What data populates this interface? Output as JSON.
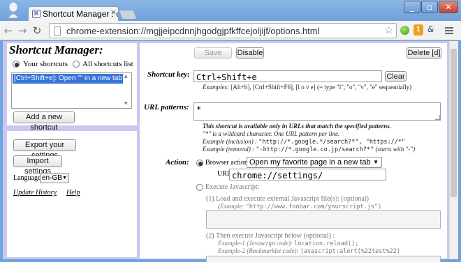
{
  "browser": {
    "tab_title": "Shortcut Manager : option",
    "address": "chrome-extension://mgjjeipcdnnjhgodgjpfkffcejoljijf/options.html",
    "ext_badge": "1"
  },
  "sidebar": {
    "title": "Shortcut Manager:",
    "view_options": [
      "Your shortcuts",
      "All shortcuts list"
    ],
    "selected_view": "Your shortcuts",
    "shortcut_list_item": "[Ctrl+Shift+e]: Open \"\" in a new tab",
    "add_button": "Add a new shortcut",
    "export_button": "Export your settings",
    "import_button": "Import settings",
    "language_label": "Language:",
    "language_value": "en-GB",
    "update_history_link": "Update History",
    "help_link": "Help"
  },
  "actions": {
    "save": "Save",
    "disable": "Disable",
    "delete": "Delete [d]"
  },
  "shortcut_key": {
    "label": "Shortcut key:",
    "value": "Ctrl+Shift+e",
    "clear": "Clear",
    "examples_prefix": "Examples:",
    "examples": "[Alt+b], [Ctrl+Shift+F6], [l o v e] (= type \"l\", \"o\", \"v\", \"e\" sequentially)"
  },
  "url_patterns": {
    "label": "URL patterns:",
    "value": "*",
    "note1": "This shortcut is available only in URLs that match the specified patterns.",
    "note2": "\"*\" is a wildcard character. One URL pattern per line.",
    "inclusion_label": "Example (inclusion) :",
    "inclusion_code": "\"http://*.google.*/search?*\", \"https://*\"",
    "removal_label": "Example (removal) :",
    "removal_code": "\"-http://*.google.co.jp/search?*\"",
    "removal_suffix": "(starts with \"-\")"
  },
  "action": {
    "label": "Action:",
    "browser_action_label": "Browser action:",
    "browser_action_value": "Open my favorite page in a new tab",
    "url_label": "URL:",
    "url_value": "chrome://settings/",
    "execute_js_label": "Execute Javascript:",
    "step1_label": "(1) Load and execute external Javascript file(s): (optional)",
    "step1_example_prefix": "(Example:",
    "step1_example_code": "\"http://www.foobar.com/yourscript.js\")",
    "step2_label": "(2) Then execute Javascript below (optional) :",
    "example1_label": "Example-1 (Javascript code):",
    "example1_code": "location.reload();",
    "example2_label": "Example-2 (Bookmarklet code):",
    "example2_code": "javascript:alert(%22test%22)"
  }
}
